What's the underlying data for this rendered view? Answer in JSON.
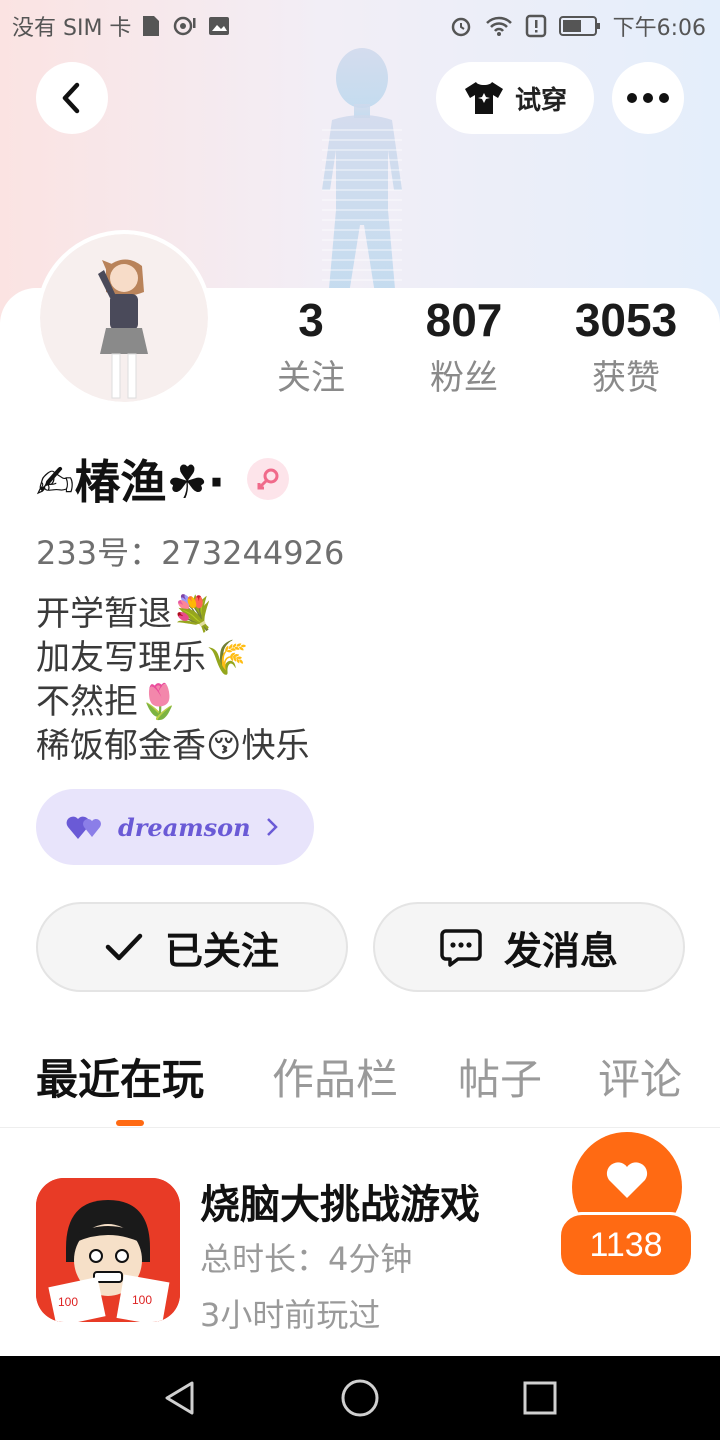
{
  "status_bar": {
    "carrier": "没有 SIM 卡",
    "time": "下午6:06",
    "icons": [
      "sim-card-icon",
      "hotspot-icon",
      "image-icon",
      "alarm-icon",
      "wifi-icon",
      "alert-icon",
      "battery-icon"
    ]
  },
  "header": {
    "back_icon": "chevron-left-icon",
    "try_on_label": "试穿",
    "try_on_icon": "shirt-icon",
    "more_icon": "more-dots-icon"
  },
  "profile": {
    "stats": [
      {
        "value": "3",
        "label": "关注"
      },
      {
        "value": "807",
        "label": "粉丝"
      },
      {
        "value": "3053",
        "label": "获赞"
      }
    ],
    "nickname": "✍椿渔☘·",
    "gender_icon": "female-icon",
    "uid_text": "233号：273244926",
    "bio_lines": [
      {
        "text": "开学暂退",
        "emoji": "💐"
      },
      {
        "text": "加友写理乐",
        "emoji": "🌾"
      },
      {
        "text": "不然拒",
        "emoji": "🌷"
      },
      {
        "text": "稀饭郁金香",
        "emoji": "😚",
        "suffix": "快乐"
      }
    ],
    "badge": {
      "text": "dreamson",
      "icon": "hearts-icon"
    }
  },
  "actions": {
    "follow_label": "已关注",
    "message_label": "发消息"
  },
  "tabs": [
    "最近在玩",
    "作品栏",
    "帖子",
    "评论"
  ],
  "recent_game": {
    "title": "烧脑大挑战游戏",
    "duration": "总时长：4分钟",
    "last_played": "3小时前玩过",
    "likes": "1138"
  },
  "colors": {
    "accent": "#ff6a13",
    "badge_bg": "#e8e4fb",
    "badge_text": "#6a5ad6"
  }
}
